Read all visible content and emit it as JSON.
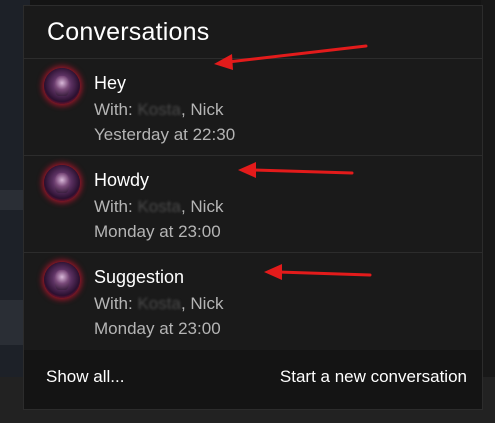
{
  "panel": {
    "title": "Conversations"
  },
  "conversations": [
    {
      "title": "Hey",
      "with_prefix": "With: ",
      "with_blurred": "Kosta",
      "with_rest": ", Nick",
      "time": "Yesterday at 22:30"
    },
    {
      "title": "Howdy",
      "with_prefix": "With: ",
      "with_blurred": "Kosta",
      "with_rest": ", Nick",
      "time": "Monday at 23:00"
    },
    {
      "title": "Suggestion",
      "with_prefix": "With: ",
      "with_blurred": "Kosta",
      "with_rest": ", Nick",
      "time": "Monday at 23:00"
    }
  ],
  "footer": {
    "show_all_label": "Show all...",
    "new_conversation_label": "Start a new conversation"
  },
  "colors": {
    "annotation_arrow": "#e31b1b",
    "avatar_glow": "#e0203a"
  }
}
